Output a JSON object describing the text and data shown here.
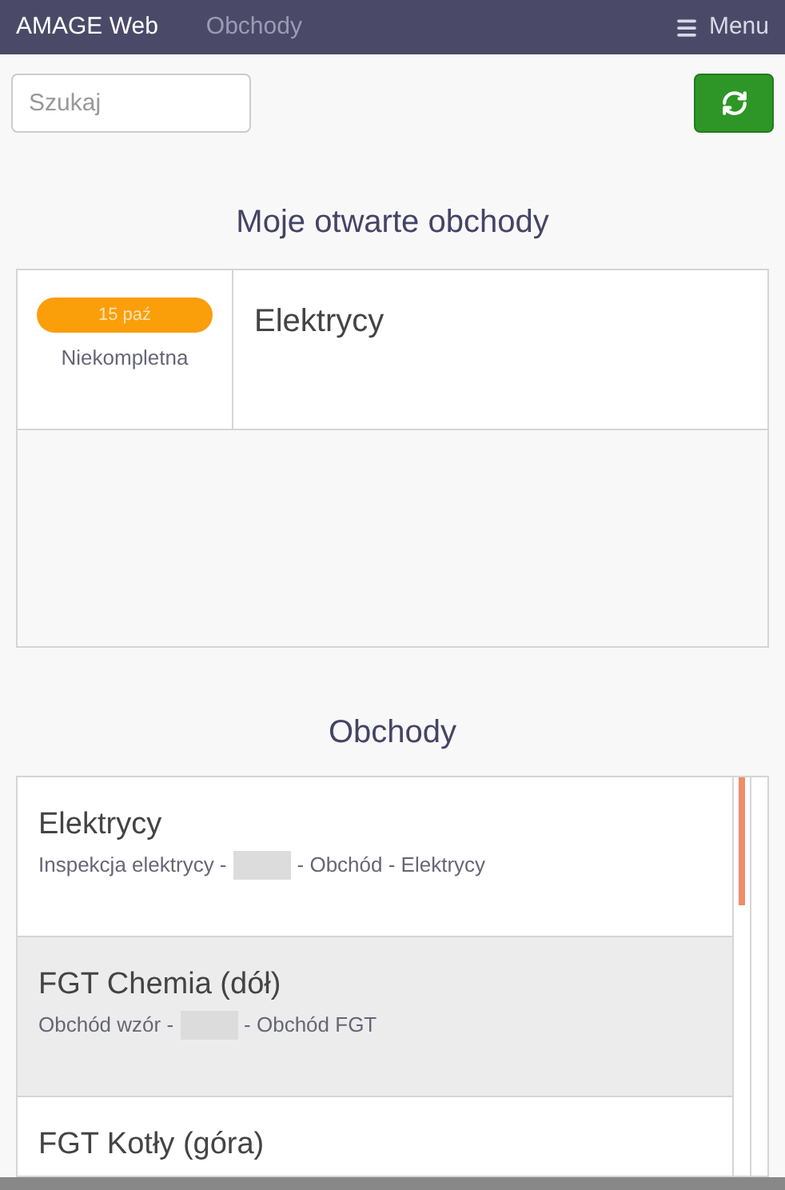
{
  "navbar": {
    "brand": "AMAGE Web",
    "link": "Obchody",
    "menu": "Menu"
  },
  "search": {
    "placeholder": "Szukaj"
  },
  "open_section": {
    "title": "Moje otwarte obchody",
    "items": [
      {
        "date": "15 paź",
        "status": "Niekompletna",
        "name": "Elektrycy"
      }
    ]
  },
  "list_section": {
    "title": "Obchody",
    "items": [
      {
        "name": "Elektrycy",
        "subtitle_before": "Inspekcja elektrycy -",
        "subtitle_after": "- Obchód - Elektrycy",
        "selected": false
      },
      {
        "name": "FGT Chemia (dół)",
        "subtitle_before": "Obchód wzór -",
        "subtitle_after": "- Obchód FGT",
        "selected": true
      },
      {
        "name": "FGT Kotły (góra)",
        "selected": false
      }
    ]
  }
}
